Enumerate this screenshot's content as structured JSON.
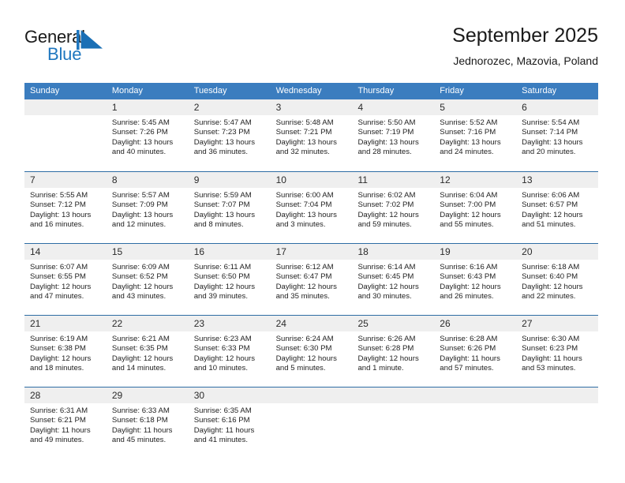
{
  "brand": {
    "name_part1": "General",
    "name_part2": "Blue",
    "logo_icon": "triangle-flag-icon",
    "accent_color": "#1f77bf"
  },
  "header": {
    "title": "September 2025",
    "subtitle": "Jednorozec, Mazovia, Poland"
  },
  "colors": {
    "header_row_bg": "#3b7dbf",
    "week_separator": "#2e6da4",
    "daynum_band_bg": "#efefef",
    "text": "#222222"
  },
  "weekdays": [
    "Sunday",
    "Monday",
    "Tuesday",
    "Wednesday",
    "Thursday",
    "Friday",
    "Saturday"
  ],
  "weeks": [
    [
      {
        "day": "",
        "lines": []
      },
      {
        "day": "1",
        "lines": [
          "Sunrise: 5:45 AM",
          "Sunset: 7:26 PM",
          "Daylight: 13 hours",
          "and 40 minutes."
        ]
      },
      {
        "day": "2",
        "lines": [
          "Sunrise: 5:47 AM",
          "Sunset: 7:23 PM",
          "Daylight: 13 hours",
          "and 36 minutes."
        ]
      },
      {
        "day": "3",
        "lines": [
          "Sunrise: 5:48 AM",
          "Sunset: 7:21 PM",
          "Daylight: 13 hours",
          "and 32 minutes."
        ]
      },
      {
        "day": "4",
        "lines": [
          "Sunrise: 5:50 AM",
          "Sunset: 7:19 PM",
          "Daylight: 13 hours",
          "and 28 minutes."
        ]
      },
      {
        "day": "5",
        "lines": [
          "Sunrise: 5:52 AM",
          "Sunset: 7:16 PM",
          "Daylight: 13 hours",
          "and 24 minutes."
        ]
      },
      {
        "day": "6",
        "lines": [
          "Sunrise: 5:54 AM",
          "Sunset: 7:14 PM",
          "Daylight: 13 hours",
          "and 20 minutes."
        ]
      }
    ],
    [
      {
        "day": "7",
        "lines": [
          "Sunrise: 5:55 AM",
          "Sunset: 7:12 PM",
          "Daylight: 13 hours",
          "and 16 minutes."
        ]
      },
      {
        "day": "8",
        "lines": [
          "Sunrise: 5:57 AM",
          "Sunset: 7:09 PM",
          "Daylight: 13 hours",
          "and 12 minutes."
        ]
      },
      {
        "day": "9",
        "lines": [
          "Sunrise: 5:59 AM",
          "Sunset: 7:07 PM",
          "Daylight: 13 hours",
          "and 8 minutes."
        ]
      },
      {
        "day": "10",
        "lines": [
          "Sunrise: 6:00 AM",
          "Sunset: 7:04 PM",
          "Daylight: 13 hours",
          "and 3 minutes."
        ]
      },
      {
        "day": "11",
        "lines": [
          "Sunrise: 6:02 AM",
          "Sunset: 7:02 PM",
          "Daylight: 12 hours",
          "and 59 minutes."
        ]
      },
      {
        "day": "12",
        "lines": [
          "Sunrise: 6:04 AM",
          "Sunset: 7:00 PM",
          "Daylight: 12 hours",
          "and 55 minutes."
        ]
      },
      {
        "day": "13",
        "lines": [
          "Sunrise: 6:06 AM",
          "Sunset: 6:57 PM",
          "Daylight: 12 hours",
          "and 51 minutes."
        ]
      }
    ],
    [
      {
        "day": "14",
        "lines": [
          "Sunrise: 6:07 AM",
          "Sunset: 6:55 PM",
          "Daylight: 12 hours",
          "and 47 minutes."
        ]
      },
      {
        "day": "15",
        "lines": [
          "Sunrise: 6:09 AM",
          "Sunset: 6:52 PM",
          "Daylight: 12 hours",
          "and 43 minutes."
        ]
      },
      {
        "day": "16",
        "lines": [
          "Sunrise: 6:11 AM",
          "Sunset: 6:50 PM",
          "Daylight: 12 hours",
          "and 39 minutes."
        ]
      },
      {
        "day": "17",
        "lines": [
          "Sunrise: 6:12 AM",
          "Sunset: 6:47 PM",
          "Daylight: 12 hours",
          "and 35 minutes."
        ]
      },
      {
        "day": "18",
        "lines": [
          "Sunrise: 6:14 AM",
          "Sunset: 6:45 PM",
          "Daylight: 12 hours",
          "and 30 minutes."
        ]
      },
      {
        "day": "19",
        "lines": [
          "Sunrise: 6:16 AM",
          "Sunset: 6:43 PM",
          "Daylight: 12 hours",
          "and 26 minutes."
        ]
      },
      {
        "day": "20",
        "lines": [
          "Sunrise: 6:18 AM",
          "Sunset: 6:40 PM",
          "Daylight: 12 hours",
          "and 22 minutes."
        ]
      }
    ],
    [
      {
        "day": "21",
        "lines": [
          "Sunrise: 6:19 AM",
          "Sunset: 6:38 PM",
          "Daylight: 12 hours",
          "and 18 minutes."
        ]
      },
      {
        "day": "22",
        "lines": [
          "Sunrise: 6:21 AM",
          "Sunset: 6:35 PM",
          "Daylight: 12 hours",
          "and 14 minutes."
        ]
      },
      {
        "day": "23",
        "lines": [
          "Sunrise: 6:23 AM",
          "Sunset: 6:33 PM",
          "Daylight: 12 hours",
          "and 10 minutes."
        ]
      },
      {
        "day": "24",
        "lines": [
          "Sunrise: 6:24 AM",
          "Sunset: 6:30 PM",
          "Daylight: 12 hours",
          "and 5 minutes."
        ]
      },
      {
        "day": "25",
        "lines": [
          "Sunrise: 6:26 AM",
          "Sunset: 6:28 PM",
          "Daylight: 12 hours",
          "and 1 minute."
        ]
      },
      {
        "day": "26",
        "lines": [
          "Sunrise: 6:28 AM",
          "Sunset: 6:26 PM",
          "Daylight: 11 hours",
          "and 57 minutes."
        ]
      },
      {
        "day": "27",
        "lines": [
          "Sunrise: 6:30 AM",
          "Sunset: 6:23 PM",
          "Daylight: 11 hours",
          "and 53 minutes."
        ]
      }
    ],
    [
      {
        "day": "28",
        "lines": [
          "Sunrise: 6:31 AM",
          "Sunset: 6:21 PM",
          "Daylight: 11 hours",
          "and 49 minutes."
        ]
      },
      {
        "day": "29",
        "lines": [
          "Sunrise: 6:33 AM",
          "Sunset: 6:18 PM",
          "Daylight: 11 hours",
          "and 45 minutes."
        ]
      },
      {
        "day": "30",
        "lines": [
          "Sunrise: 6:35 AM",
          "Sunset: 6:16 PM",
          "Daylight: 11 hours",
          "and 41 minutes."
        ]
      },
      {
        "day": "",
        "lines": []
      },
      {
        "day": "",
        "lines": []
      },
      {
        "day": "",
        "lines": []
      },
      {
        "day": "",
        "lines": []
      }
    ]
  ]
}
